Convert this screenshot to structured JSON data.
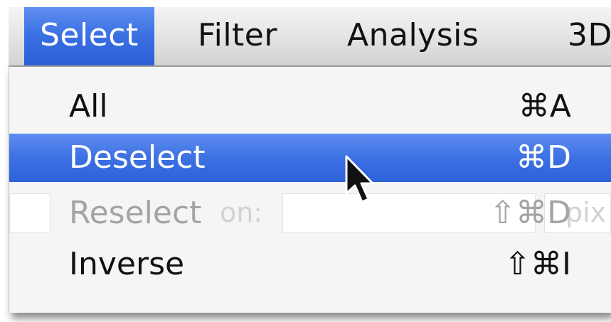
{
  "menubar": {
    "items": [
      {
        "label": "Select",
        "active": true
      },
      {
        "label": "Filter",
        "active": false
      },
      {
        "label": "Analysis",
        "active": false
      },
      {
        "label": "3D",
        "active": false
      }
    ]
  },
  "dropdown": {
    "items": [
      {
        "label": "All",
        "shortcut": "⌘A",
        "state": "enabled"
      },
      {
        "label": "Deselect",
        "shortcut": "⌘D",
        "state": "highlighted"
      },
      {
        "label": "Reselect",
        "shortcut": "⇧⌘D",
        "state": "disabled"
      },
      {
        "label": "Inverse",
        "shortcut": "⇧⌘I",
        "state": "enabled"
      }
    ]
  },
  "background": {
    "label_fragment": "on:",
    "field_fragment": "pix"
  },
  "colors": {
    "highlight": "#3a6fe2",
    "menu_background": "#f5f5f5",
    "disabled_text": "#a4a4a4"
  },
  "icons": {
    "cursor": "arrow-pointer-icon"
  }
}
